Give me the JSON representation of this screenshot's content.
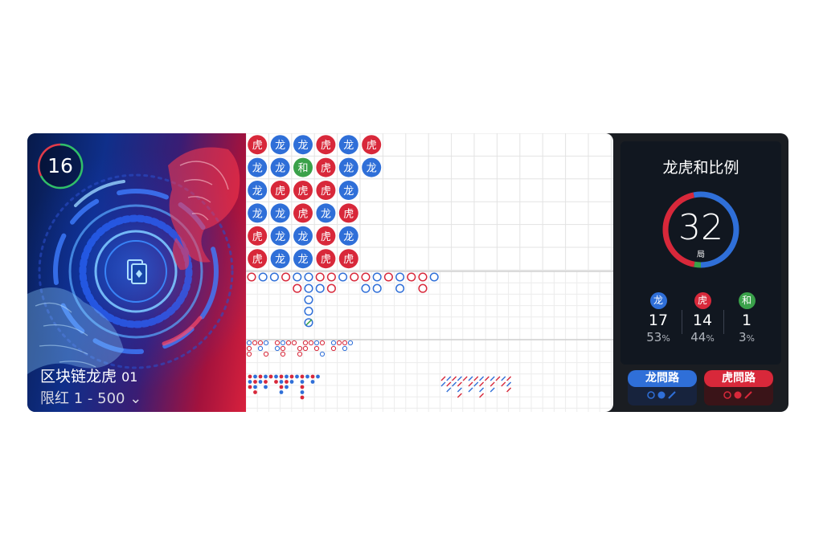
{
  "table": {
    "round_count": "16",
    "name": "区块链龙虎",
    "code": "01",
    "limit": "限红 1 - 500"
  },
  "bead_road": {
    "columns": [
      [
        "虎",
        "龙",
        "龙",
        "龙",
        "虎",
        "虎"
      ],
      [
        "龙",
        "龙",
        "虎",
        "龙",
        "龙",
        "龙"
      ],
      [
        "龙",
        "和",
        "虎",
        "虎",
        "龙",
        "龙"
      ],
      [
        "虎",
        "虎",
        "虎",
        "龙",
        "虎",
        "虎"
      ],
      [
        "龙",
        "龙",
        "龙",
        "虎",
        "龙",
        "虎"
      ],
      [
        "虎",
        "龙"
      ]
    ]
  },
  "stats": {
    "title": "龙虎和比例",
    "total": "32",
    "total_unit": "局",
    "dragon": {
      "label": "龙",
      "count": "17",
      "pct": "53",
      "color": "#2f6fd8"
    },
    "tiger": {
      "label": "虎",
      "count": "14",
      "pct": "44",
      "color": "#d8283a"
    },
    "tie": {
      "label": "和",
      "count": "1",
      "pct": "3",
      "color": "#3aa14a"
    },
    "pct_sign": "%"
  },
  "ask_roads": {
    "dragon": {
      "label": "龙問路"
    },
    "tiger": {
      "label": "虎問路"
    }
  }
}
